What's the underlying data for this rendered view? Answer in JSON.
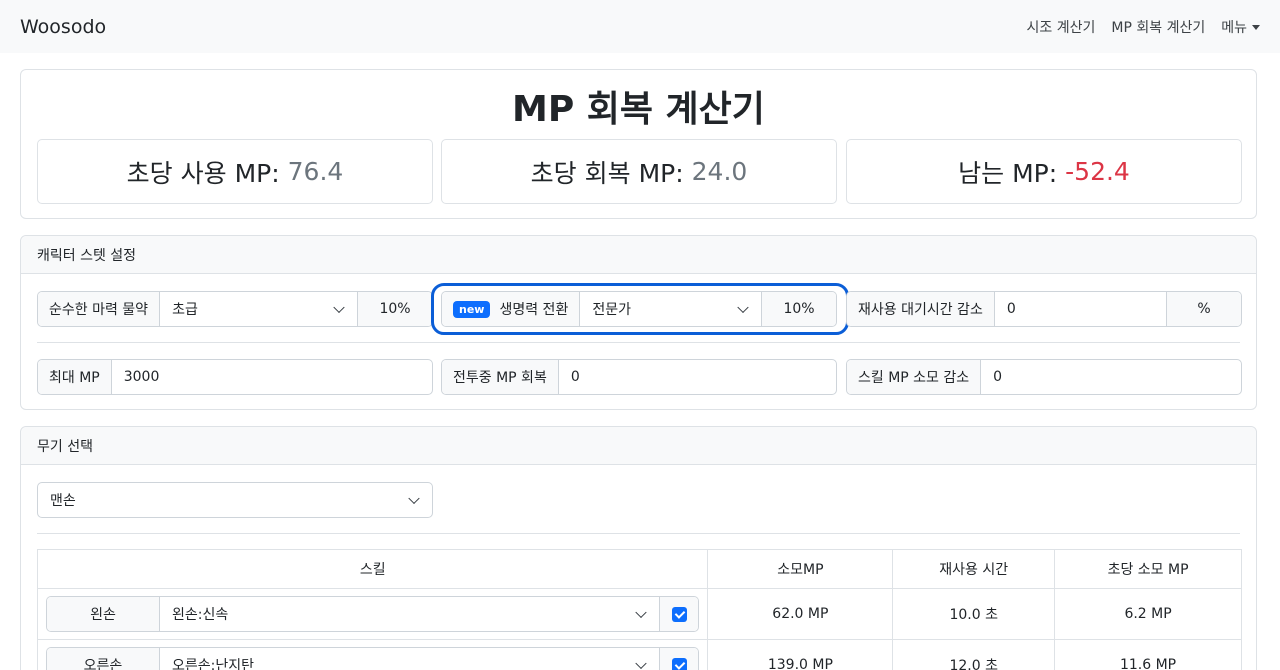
{
  "navbar": {
    "brand": "Woosodo",
    "links": [
      "시조 계산기",
      "MP 회복 계산기",
      "메뉴"
    ]
  },
  "summary": {
    "title": "MP 회복 계산기",
    "stats": [
      {
        "label": "초당 사용 MP:",
        "value": "76.4"
      },
      {
        "label": "초당 회복 MP:",
        "value": "24.0"
      },
      {
        "label": "남는 MP:",
        "value": "-52.4"
      }
    ]
  },
  "stats_card": {
    "header": "캐릭터 스텟 설정",
    "pure_mana": {
      "label": "순수한 마력 물약",
      "value": "초급",
      "suffix": "10%"
    },
    "life_conversion": {
      "badge": "new",
      "label": "생명력 전환",
      "value": "전문가",
      "suffix": "10%"
    },
    "cooldown": {
      "label": "재사용 대기시간 감소",
      "value": "0",
      "suffix": "%"
    },
    "max_mp": {
      "label": "최대 MP",
      "value": "3000"
    },
    "combat_regen": {
      "label": "전투중 MP 회복",
      "value": "0"
    },
    "skill_cost": {
      "label": "스킬 MP 소모 감소",
      "value": "0"
    }
  },
  "weapon_card": {
    "header": "무기 선택",
    "weapon_select": "맨손",
    "table": {
      "headers": [
        "스킬",
        "소모MP",
        "재사용 시간",
        "초당 소모 MP"
      ],
      "rows": [
        {
          "hand": "왼손",
          "skill": "왼손:신속",
          "checked": true,
          "mp": "62.0 MP",
          "cooldown": "10.0 초",
          "per_sec": "6.2 MP"
        },
        {
          "hand": "오른손",
          "skill": "오른손:난지탄",
          "checked": true,
          "mp": "139.0 MP",
          "cooldown": "12.0 초",
          "per_sec": "11.6 MP"
        }
      ]
    }
  },
  "colors": {
    "accent": "#0d6efd",
    "negative": "#dc3545",
    "muted": "#6c757d"
  }
}
